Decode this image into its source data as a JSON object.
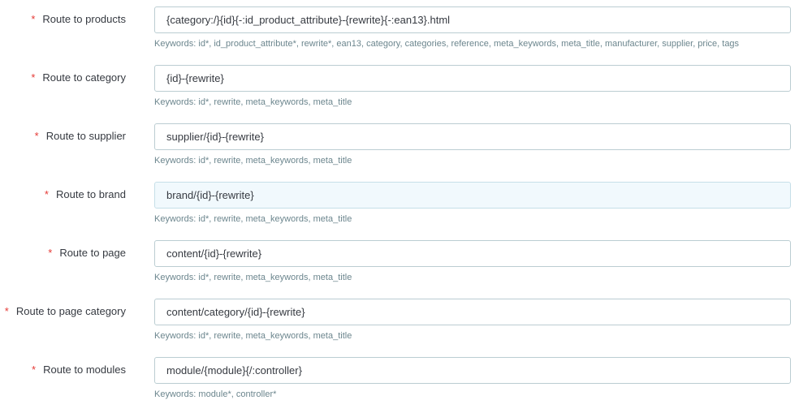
{
  "required_marker": "*",
  "routes": [
    {
      "label": "Route to products",
      "value": "{category:/}{id}{-:id_product_attribute}-{rewrite}{-:ean13}.html",
      "keywords": "Keywords: id*, id_product_attribute*, rewrite*, ean13, category, categories, reference, meta_keywords, meta_title, manufacturer, supplier, price, tags"
    },
    {
      "label": "Route to category",
      "value": "{id}-{rewrite}",
      "keywords": "Keywords: id*, rewrite, meta_keywords, meta_title"
    },
    {
      "label": "Route to supplier",
      "value": "supplier/{id}-{rewrite}",
      "keywords": "Keywords: id*, rewrite, meta_keywords, meta_title"
    },
    {
      "label": "Route to brand",
      "value": "brand/{id}-{rewrite}",
      "keywords": "Keywords: id*, rewrite, meta_keywords, meta_title"
    },
    {
      "label": "Route to page",
      "value": "content/{id}-{rewrite}",
      "keywords": "Keywords: id*, rewrite, meta_keywords, meta_title"
    },
    {
      "label": "Route to page category",
      "value": "content/category/{id}-{rewrite}",
      "keywords": "Keywords: id*, rewrite, meta_keywords, meta_title"
    },
    {
      "label": "Route to modules",
      "value": "module/{module}{/:controller}",
      "keywords": "Keywords: module*, controller*"
    }
  ],
  "colors": {
    "required": "#e53935",
    "help_text": "#6c868e",
    "input_border": "#bbcdd2",
    "focused_input_bg": "#f1f9fd"
  }
}
